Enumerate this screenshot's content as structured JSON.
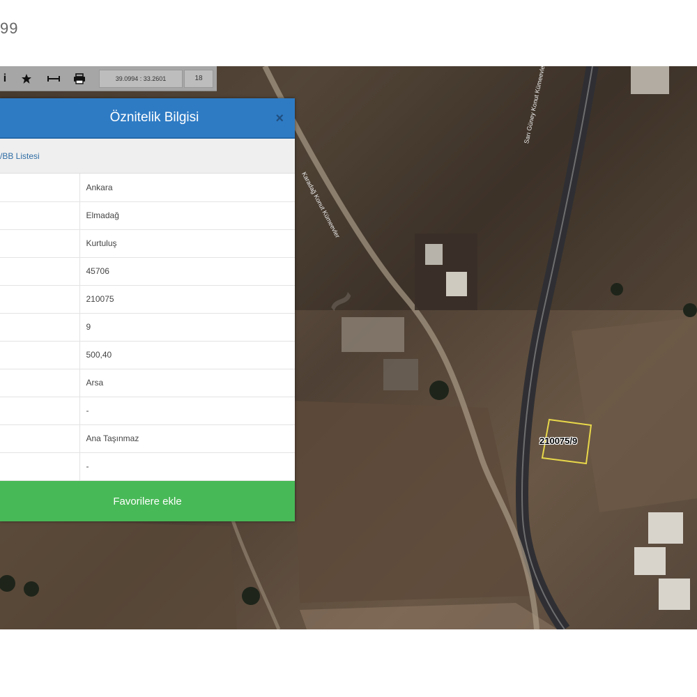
{
  "page": {
    "top_text": "99"
  },
  "toolbar": {
    "coords": "39.0994 : 33.2601",
    "zoom": "18"
  },
  "panel": {
    "title": "Öznitelik Bilgisi",
    "close": "×",
    "sub_link": "/BB Listesi",
    "rows": [
      {
        "value": "Ankara"
      },
      {
        "value": "Elmadağ"
      },
      {
        "value": "Kurtuluş"
      },
      {
        "value": "45706"
      },
      {
        "value": "210075"
      },
      {
        "value": "9"
      },
      {
        "value": "500,40"
      },
      {
        "value": "Arsa"
      },
      {
        "value": "-"
      },
      {
        "value": "Ana Taşınmaz"
      },
      {
        "value": "-"
      }
    ],
    "favorite_button": "Favorilere ekle"
  },
  "map": {
    "parcel_label": "210075/9",
    "road_labels": [
      "Sarı Güney Konut Kümeevler",
      "Karadağ Konut Kümeevler"
    ]
  },
  "colors": {
    "header_blue": "#2e7bc4",
    "button_green": "#48b957",
    "parcel_outline": "#e8d84a"
  }
}
